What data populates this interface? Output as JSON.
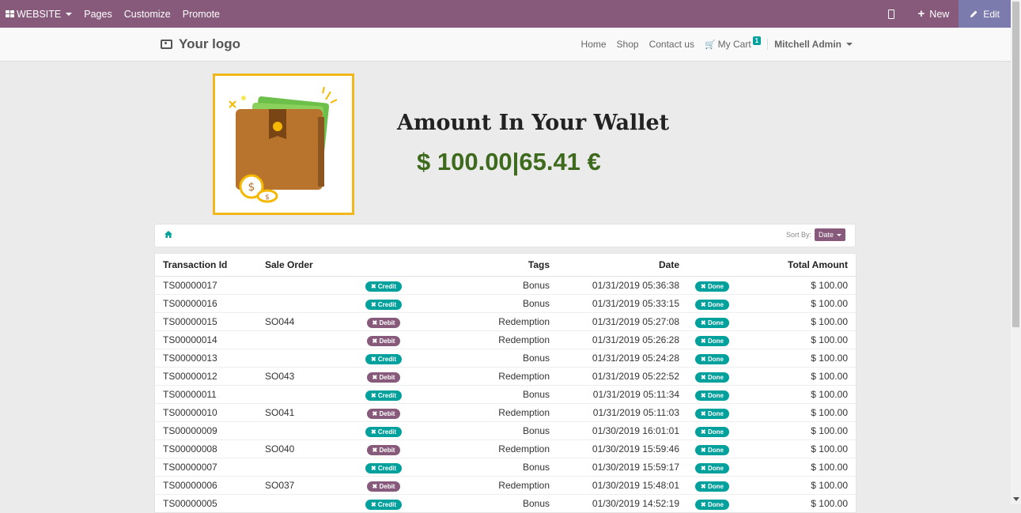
{
  "adminbar": {
    "website_label": "WEBSITE",
    "pages_label": "Pages",
    "customize_label": "Customize",
    "promote_label": "Promote",
    "new_label": "New",
    "edit_label": "Edit"
  },
  "navbar": {
    "logo_text": "Your logo",
    "home": "Home",
    "shop": "Shop",
    "contact": "Contact us",
    "cart": "My Cart",
    "cart_count": "1",
    "user": "Mitchell Admin"
  },
  "hero": {
    "title": "Amount In Your Wallet",
    "amount": "$ 100.00|65.41 €"
  },
  "sort": {
    "label": "Sort By:",
    "value": "Date"
  },
  "table": {
    "headers": [
      "Transaction Id",
      "Sale Order",
      "",
      "Tags",
      "Date",
      "",
      "Total Amount"
    ],
    "rows": [
      {
        "id": "TS00000017",
        "so": "",
        "type": "Credit",
        "tag": "Bonus",
        "date": "01/31/2019 05:36:38",
        "state": "Done",
        "amount": "$ 100.00"
      },
      {
        "id": "TS00000016",
        "so": "",
        "type": "Credit",
        "tag": "Bonus",
        "date": "01/31/2019 05:33:15",
        "state": "Done",
        "amount": "$ 100.00"
      },
      {
        "id": "TS00000015",
        "so": "SO044",
        "type": "Debit",
        "tag": "Redemption",
        "date": "01/31/2019 05:27:08",
        "state": "Done",
        "amount": "$ 100.00"
      },
      {
        "id": "TS00000014",
        "so": "",
        "type": "Debit",
        "tag": "Redemption",
        "date": "01/31/2019 05:26:28",
        "state": "Done",
        "amount": "$ 100.00"
      },
      {
        "id": "TS00000013",
        "so": "",
        "type": "Credit",
        "tag": "Bonus",
        "date": "01/31/2019 05:24:28",
        "state": "Done",
        "amount": "$ 100.00"
      },
      {
        "id": "TS00000012",
        "so": "SO043",
        "type": "Debit",
        "tag": "Redemption",
        "date": "01/31/2019 05:22:52",
        "state": "Done",
        "amount": "$ 100.00"
      },
      {
        "id": "TS00000011",
        "so": "",
        "type": "Credit",
        "tag": "Bonus",
        "date": "01/31/2019 05:11:34",
        "state": "Done",
        "amount": "$ 100.00"
      },
      {
        "id": "TS00000010",
        "so": "SO041",
        "type": "Debit",
        "tag": "Redemption",
        "date": "01/31/2019 05:11:03",
        "state": "Done",
        "amount": "$ 100.00"
      },
      {
        "id": "TS00000009",
        "so": "",
        "type": "Credit",
        "tag": "Bonus",
        "date": "01/30/2019 16:01:01",
        "state": "Done",
        "amount": "$ 100.00"
      },
      {
        "id": "TS00000008",
        "so": "SO040",
        "type": "Debit",
        "tag": "Redemption",
        "date": "01/30/2019 15:59:46",
        "state": "Done",
        "amount": "$ 100.00"
      },
      {
        "id": "TS00000007",
        "so": "",
        "type": "Credit",
        "tag": "Bonus",
        "date": "01/30/2019 15:59:17",
        "state": "Done",
        "amount": "$ 100.00"
      },
      {
        "id": "TS00000006",
        "so": "SO037",
        "type": "Debit",
        "tag": "Redemption",
        "date": "01/30/2019 15:48:01",
        "state": "Done",
        "amount": "$ 100.00"
      },
      {
        "id": "TS00000005",
        "so": "",
        "type": "Credit",
        "tag": "Bonus",
        "date": "01/30/2019 14:52:19",
        "state": "Done",
        "amount": "$ 100.00"
      }
    ]
  },
  "icons": {
    "website": "grid-icon",
    "mobile": "mobile-preview-icon",
    "new": "plus-icon",
    "edit": "pencil-icon",
    "logo": "camera-icon",
    "cart": "cart-icon",
    "home": "home-icon",
    "credit_debit_done": "times-icon"
  },
  "colors": {
    "brand": "#875a7b",
    "teal": "#00a09d",
    "edit": "#7c7bad",
    "amount": "#3e6a1e",
    "wallet_border": "#f2b71b"
  }
}
